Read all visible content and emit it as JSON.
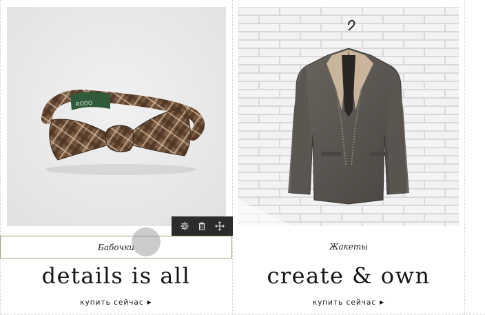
{
  "colors": {
    "selection_border": "#9aa07c",
    "toolbar_bg": "#2b2b2b",
    "text": "#151515"
  },
  "cards": [
    {
      "image": "bow-tie-photo",
      "category": "Бабочки",
      "headline": "details is all",
      "buy_label": "купить сейчас",
      "selected": true
    },
    {
      "image": "jacket-on-brick-wall-photo",
      "category": "Жакеты",
      "headline": "create & own",
      "buy_label": "купить сейчас",
      "selected": false
    }
  ],
  "toolbar": {
    "icons": [
      "gear-icon",
      "trash-icon",
      "move-icon"
    ]
  }
}
